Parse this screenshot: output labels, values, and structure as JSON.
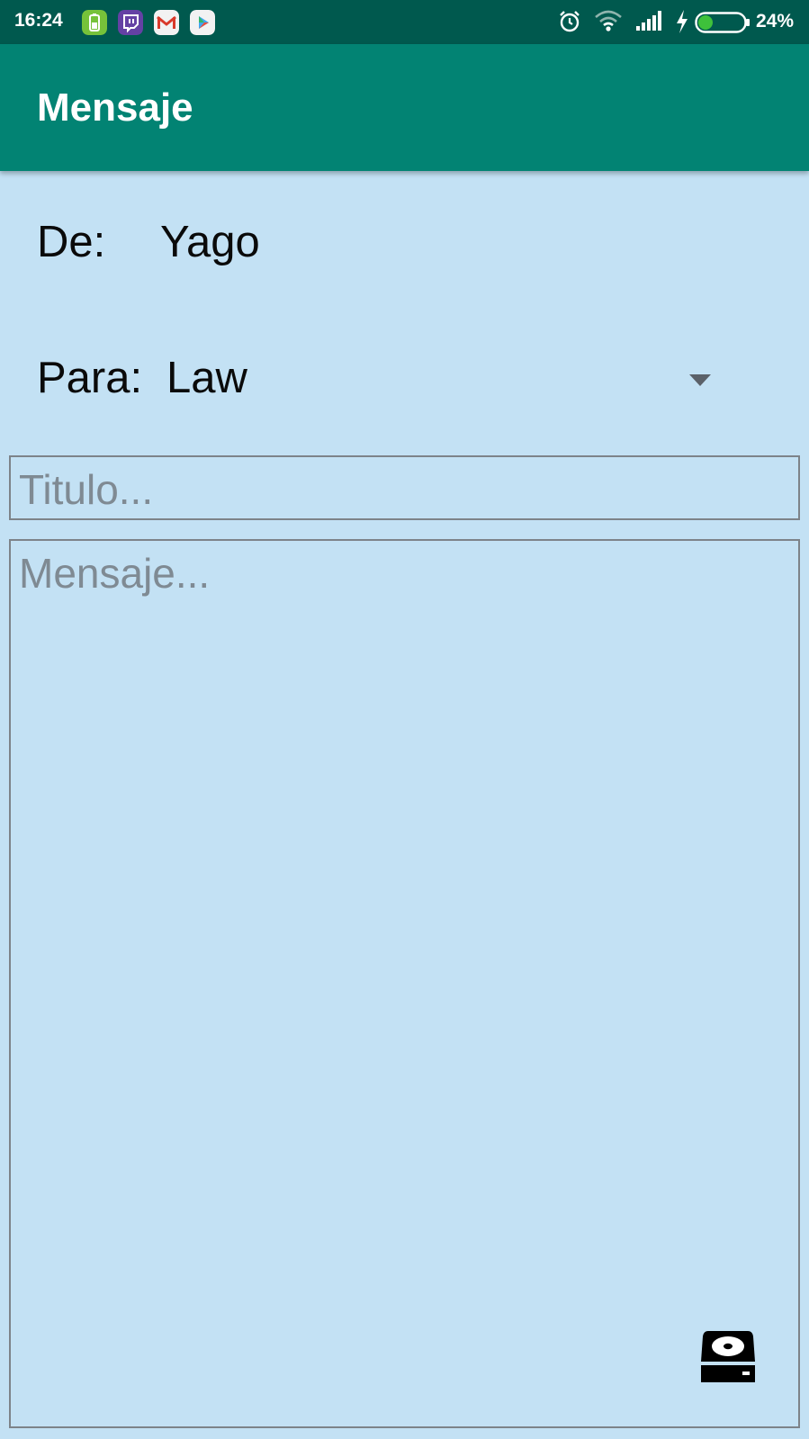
{
  "status_bar": {
    "time": "16:24",
    "battery_percent": "24%",
    "left_icons": [
      "battery-app-icon",
      "twitch-icon",
      "gmail-icon",
      "play-store-icon"
    ],
    "right_icons": [
      "alarm-icon",
      "wifi-icon",
      "signal-icon",
      "charging-icon",
      "battery-icon"
    ],
    "battery_level": 0.24
  },
  "app_bar": {
    "title": "Mensaje",
    "color": "#028373"
  },
  "form": {
    "from_label": "De:",
    "from_value": "Yago",
    "to_label": "Para:",
    "to_selected": "Law",
    "title_placeholder": "Titulo...",
    "message_placeholder": "Mensaje..."
  },
  "actions": {
    "save_icon": "hard-drive-save-icon"
  },
  "colors": {
    "status_bar": "#00594e",
    "background": "#c3e1f4"
  }
}
